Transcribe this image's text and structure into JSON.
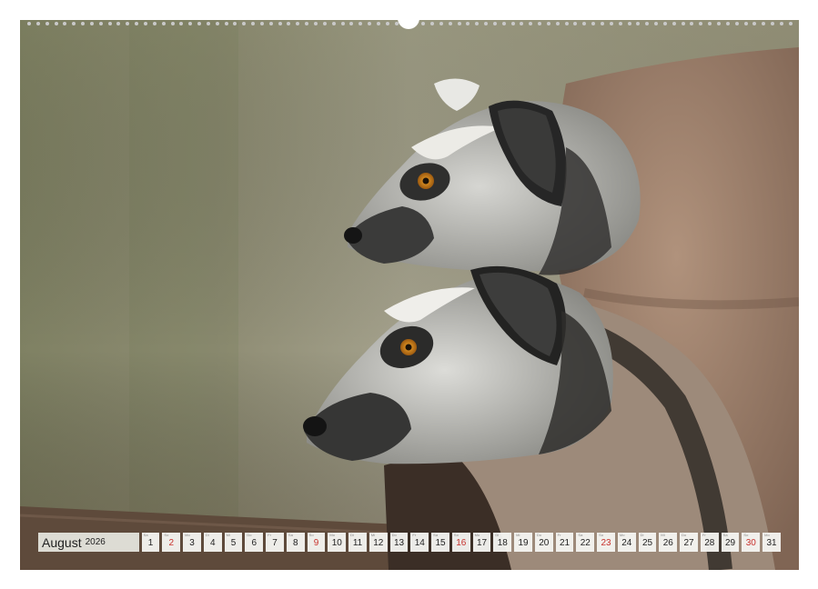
{
  "calendar": {
    "month": "August",
    "year": "2026",
    "days": [
      {
        "num": "1",
        "wd": "Sa",
        "sunday": false
      },
      {
        "num": "2",
        "wd": "So",
        "sunday": true
      },
      {
        "num": "3",
        "wd": "Mo",
        "sunday": false
      },
      {
        "num": "4",
        "wd": "Di",
        "sunday": false
      },
      {
        "num": "5",
        "wd": "Mi",
        "sunday": false
      },
      {
        "num": "6",
        "wd": "Do",
        "sunday": false
      },
      {
        "num": "7",
        "wd": "Fr",
        "sunday": false
      },
      {
        "num": "8",
        "wd": "Sa",
        "sunday": false
      },
      {
        "num": "9",
        "wd": "So",
        "sunday": true
      },
      {
        "num": "10",
        "wd": "Mo",
        "sunday": false
      },
      {
        "num": "11",
        "wd": "Di",
        "sunday": false
      },
      {
        "num": "12",
        "wd": "Mi",
        "sunday": false
      },
      {
        "num": "13",
        "wd": "Do",
        "sunday": false
      },
      {
        "num": "14",
        "wd": "Fr",
        "sunday": false
      },
      {
        "num": "15",
        "wd": "Sa",
        "sunday": false
      },
      {
        "num": "16",
        "wd": "So",
        "sunday": true
      },
      {
        "num": "17",
        "wd": "Mo",
        "sunday": false
      },
      {
        "num": "18",
        "wd": "Di",
        "sunday": false
      },
      {
        "num": "19",
        "wd": "Mi",
        "sunday": false
      },
      {
        "num": "20",
        "wd": "Do",
        "sunday": false
      },
      {
        "num": "21",
        "wd": "Fr",
        "sunday": false
      },
      {
        "num": "22",
        "wd": "Sa",
        "sunday": false
      },
      {
        "num": "23",
        "wd": "So",
        "sunday": true
      },
      {
        "num": "24",
        "wd": "Mo",
        "sunday": false
      },
      {
        "num": "25",
        "wd": "Di",
        "sunday": false
      },
      {
        "num": "26",
        "wd": "Mi",
        "sunday": false
      },
      {
        "num": "27",
        "wd": "Do",
        "sunday": false
      },
      {
        "num": "28",
        "wd": "Fr",
        "sunday": false
      },
      {
        "num": "29",
        "wd": "Sa",
        "sunday": false
      },
      {
        "num": "30",
        "wd": "So",
        "sunday": true
      },
      {
        "num": "31",
        "wd": "Mo",
        "sunday": false
      }
    ]
  },
  "colors": {
    "sunday": "#c8322d",
    "cell_background": "#f6f6f2",
    "fur_grey": "#b9b9b4",
    "fur_brown": "#a08470",
    "eye": "#e0901c"
  },
  "photo": {
    "subject": "ring-tailed-lemurs"
  }
}
